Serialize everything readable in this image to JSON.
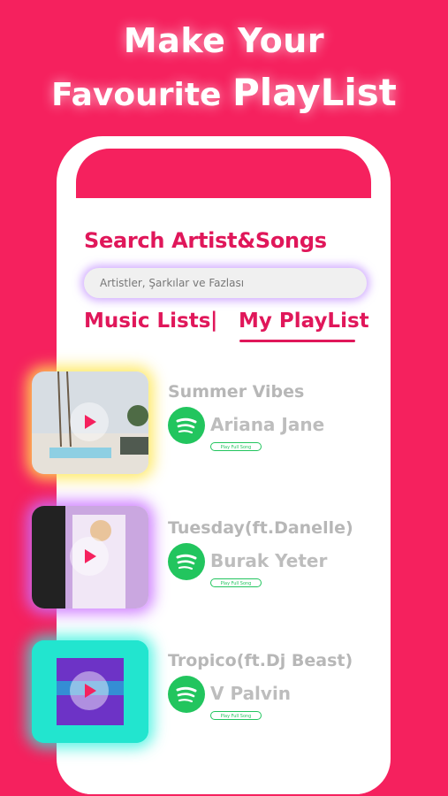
{
  "headline": {
    "line1": "Make Your",
    "line2_prefix": "Favourite",
    "line2_big": "PlayList"
  },
  "search": {
    "title": "Search Artist&Songs",
    "placeholder": "Artistler, Şarkılar ve Fazlası"
  },
  "tabs": {
    "music_lists": "Music Lists",
    "separator": "|",
    "my_playlist": "My PlayList"
  },
  "songs": [
    {
      "title": "Summer Vibes",
      "artist": "Ariana Jane",
      "button": "Play Full Song"
    },
    {
      "title": "Tuesday(ft.Danelle)",
      "artist": "Burak Yeter",
      "button": "Play Full Song"
    },
    {
      "title": "Tropico(ft.Dj Beast)",
      "artist": "V Palvin",
      "button": "Play Full Song"
    }
  ],
  "colors": {
    "brand": "#f5215e",
    "accent_text": "#e0175a",
    "spotify": "#22c55e"
  },
  "icons": {
    "play": "play-icon",
    "spotify": "spotify-icon"
  }
}
